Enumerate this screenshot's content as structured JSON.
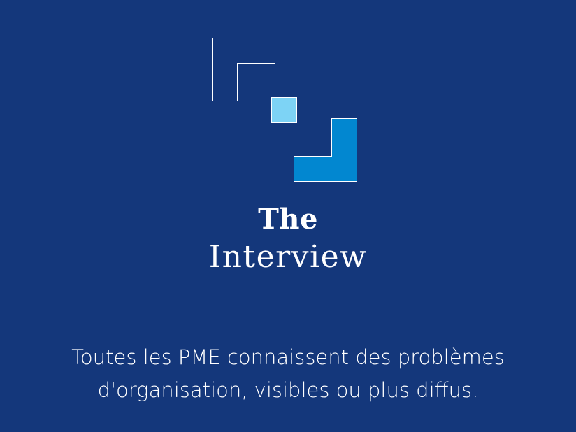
{
  "brand": {
    "title_line1": "The",
    "title_line2": "Interview"
  },
  "intro": {
    "text_line1": "Toutes les PME connaissent des problèmes",
    "text_line2": "d'organisation, visibles ou plus diffus."
  },
  "colors": {
    "background": "#14377b",
    "text": "#ffffff",
    "logo_outline": "#ffffff",
    "logo_light_square": "#7dd3f5",
    "logo_blue_corner": "#0287d0"
  },
  "icons": {
    "logo": "brand-logo-icon"
  }
}
